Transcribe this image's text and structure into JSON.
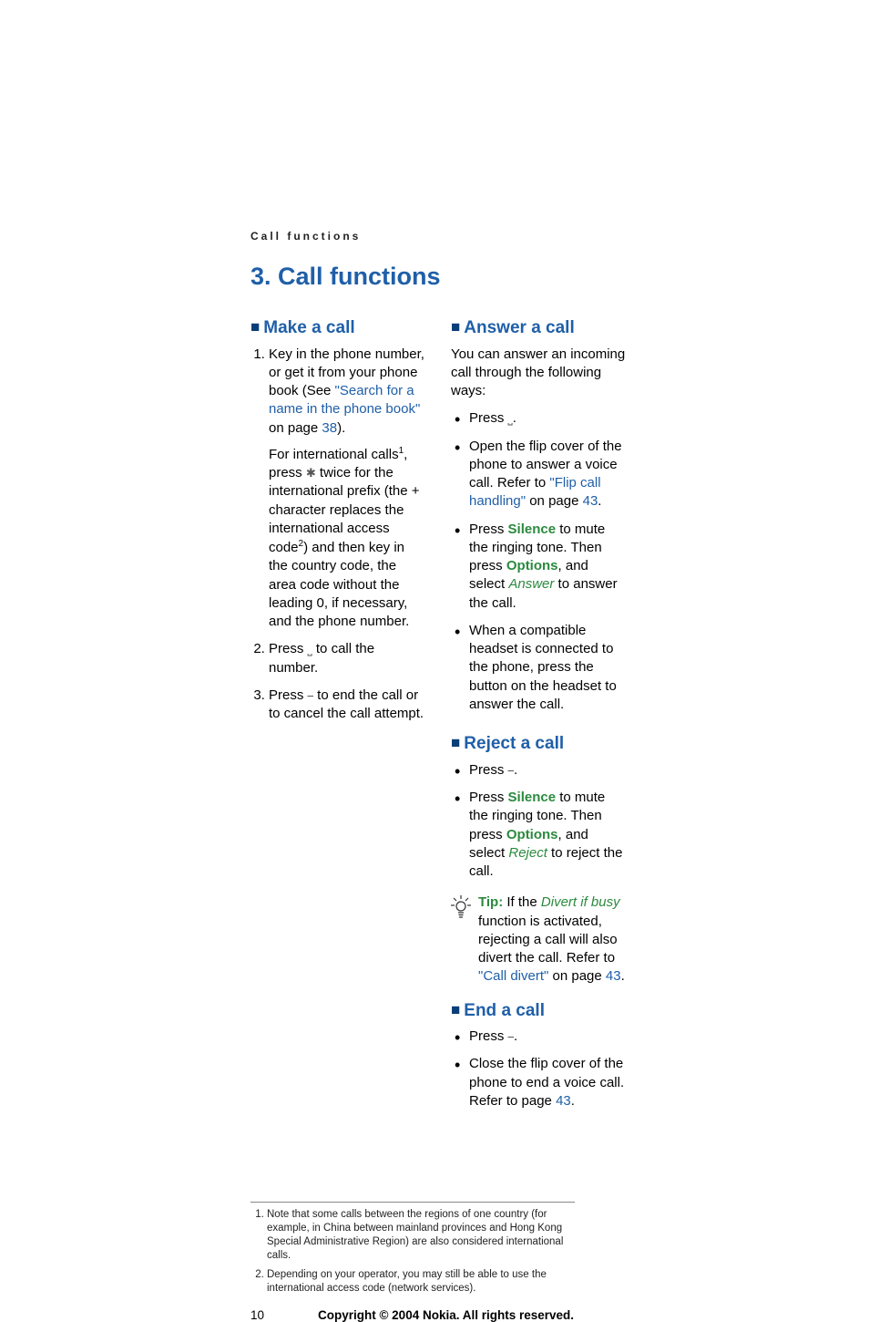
{
  "running_header": "Call functions",
  "chapter_title": "3. Call functions",
  "make_a_call": {
    "title": "Make a call",
    "item1_a": "Key in the phone number, or get it from your phone book (See ",
    "item1_link": "\"Search for a name in the phone book\"",
    "item1_b": " on page ",
    "item1_page": "38",
    "item1_c": ").",
    "item1_sub_a": "For international calls",
    "item1_sub_fn1": "1",
    "item1_sub_b": ", press ",
    "item1_key": "✱",
    "item1_sub_c": " twice for the international prefix (the + character replaces the international access code",
    "item1_sub_fn2": "2",
    "item1_sub_d": ") and then key in the country code, the area code without the leading 0, if necessary, and the phone number.",
    "item2_a": "Press ",
    "item2_key": "⎵",
    "item2_b": " to call the number.",
    "item3_a": "Press ",
    "item3_key": "⎯",
    "item3_b": " to end the call or to cancel the call attempt."
  },
  "answer_a_call": {
    "title": "Answer a call",
    "intro": "You can answer an incoming call through the following ways:",
    "b1_a": "Press ",
    "b1_key": "⎵",
    "b1_b": ".",
    "b2_a": "Open the flip cover of the phone to answer a voice call. Refer to ",
    "b2_link": "\"Flip call handling\"",
    "b2_b": " on page ",
    "b2_page": "43",
    "b2_c": ".",
    "b3_a": "Press ",
    "b3_silence": "Silence",
    "b3_b": " to mute the ringing tone. Then press ",
    "b3_options": "Options",
    "b3_c": ", and select ",
    "b3_answer": "Answer",
    "b3_d": " to answer the call.",
    "b4": "When a compatible headset is connected to the phone, press the button on the headset to answer the call."
  },
  "reject_a_call": {
    "title": "Reject a call",
    "b1_a": "Press ",
    "b1_key": "⎯",
    "b1_b": ".",
    "b2_a": "Press ",
    "b2_silence": "Silence",
    "b2_b": " to mute the ringing tone. Then press ",
    "b2_options": "Options",
    "b2_c": ", and select ",
    "b2_reject": "Reject",
    "b2_d": " to reject the call.",
    "tip_label": "Tip:",
    "tip_a": " If the ",
    "tip_divert": "Divert if busy",
    "tip_b": " function is activated, rejecting a call will also divert the call. Refer to ",
    "tip_link": "\"Call divert\"",
    "tip_c": " on page ",
    "tip_page": "43",
    "tip_d": "."
  },
  "end_a_call": {
    "title": "End a call",
    "b1_a": "Press ",
    "b1_key": "⎯",
    "b1_b": ".",
    "b2_a": "Close the flip cover of the phone to end a voice call. Refer to page ",
    "b2_page": "43",
    "b2_b": "."
  },
  "footnotes": {
    "f1": "Note that some calls between the regions of one country (for example, in China between mainland provinces and Hong Kong Special Administrative Region) are also considered international calls.",
    "f2": "Depending on your operator, you may still be able to use the international access code (network services)."
  },
  "footer": {
    "page_number": "10",
    "copyright": "Copyright © 2004 Nokia. All rights reserved."
  }
}
